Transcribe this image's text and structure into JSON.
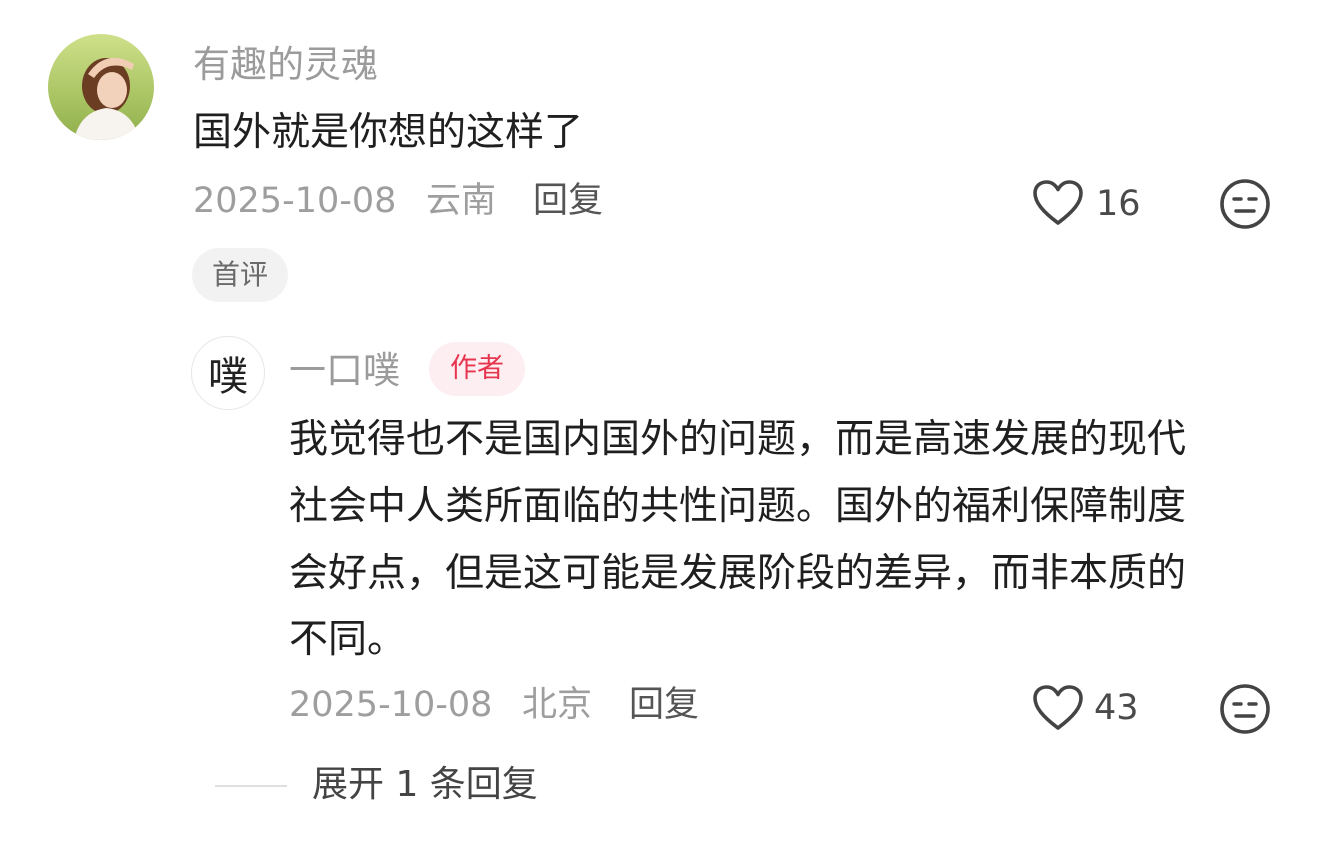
{
  "comment": {
    "username": "有趣的灵魂",
    "text": "国外就是你想的这样了",
    "date": "2025-10-08",
    "location": "云南",
    "reply_label": "回复",
    "likes": "16",
    "badge": "首评"
  },
  "reply": {
    "avatar_char": "噗",
    "username": "一口噗",
    "author_badge": "作者",
    "lines": [
      "我觉得也不是国内国外的问题，而是高速发展的现代",
      "社会中人类所面临的共性问题。国外的福利保障制度",
      "会好点，但是这可能是发展阶段的差异，而非本质的",
      "不同。"
    ],
    "date": "2025-10-08",
    "location": "北京",
    "reply_label": "回复",
    "likes": "43"
  },
  "expand": {
    "label": "展开 1 条回复"
  },
  "colors": {
    "author_badge_text": "#e8354f",
    "author_badge_bg": "#fdeef1",
    "muted_text": "#9e9e9e"
  },
  "icons": [
    "heart-outline-icon",
    "neutral-face-icon"
  ]
}
